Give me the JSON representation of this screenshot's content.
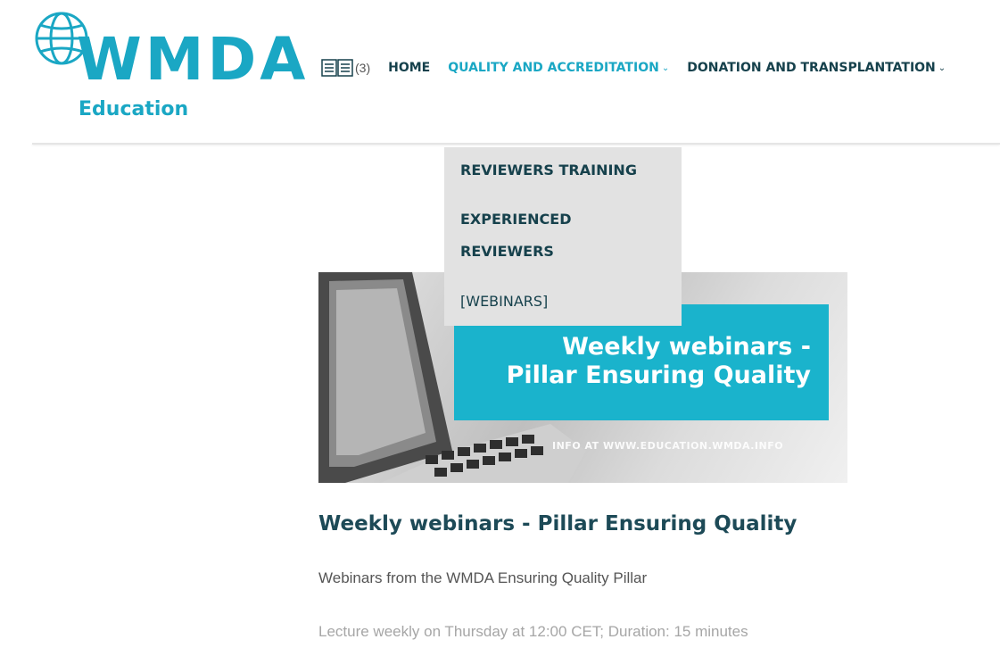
{
  "brand": {
    "logo_text": "WMDA",
    "logo_subtitle": "Education",
    "color": "#1aa7c4"
  },
  "nav": {
    "book_icon": "book-open-icon",
    "book_count": "(3)",
    "items": [
      {
        "label": "HOME",
        "has_dropdown": false
      },
      {
        "label": "QUALITY AND ACCREDITATION",
        "has_dropdown": true,
        "active": true
      },
      {
        "label": "DONATION AND TRANSPLANTATION",
        "has_dropdown": true
      }
    ]
  },
  "dropdown": {
    "items": [
      {
        "label": "REVIEWERS TRAINING"
      },
      {
        "label_line1": "EXPERIENCED",
        "label_line2": "REVIEWERS"
      },
      {
        "label": "[WEBINARS]"
      }
    ]
  },
  "banner": {
    "title_line1": "Weekly webinars -",
    "title_line2": "Pillar Ensuring Quality",
    "info": "INFO AT WWW.EDUCATION.WMDA.INFO",
    "box_color": "#1ab3cc"
  },
  "article": {
    "title": "Weekly webinars - Pillar Ensuring Quality",
    "description": "Webinars from the WMDA Ensuring Quality Pillar",
    "lecture": "Lecture weekly on Thursday at 12:00 CET; Duration: 15 minutes"
  }
}
